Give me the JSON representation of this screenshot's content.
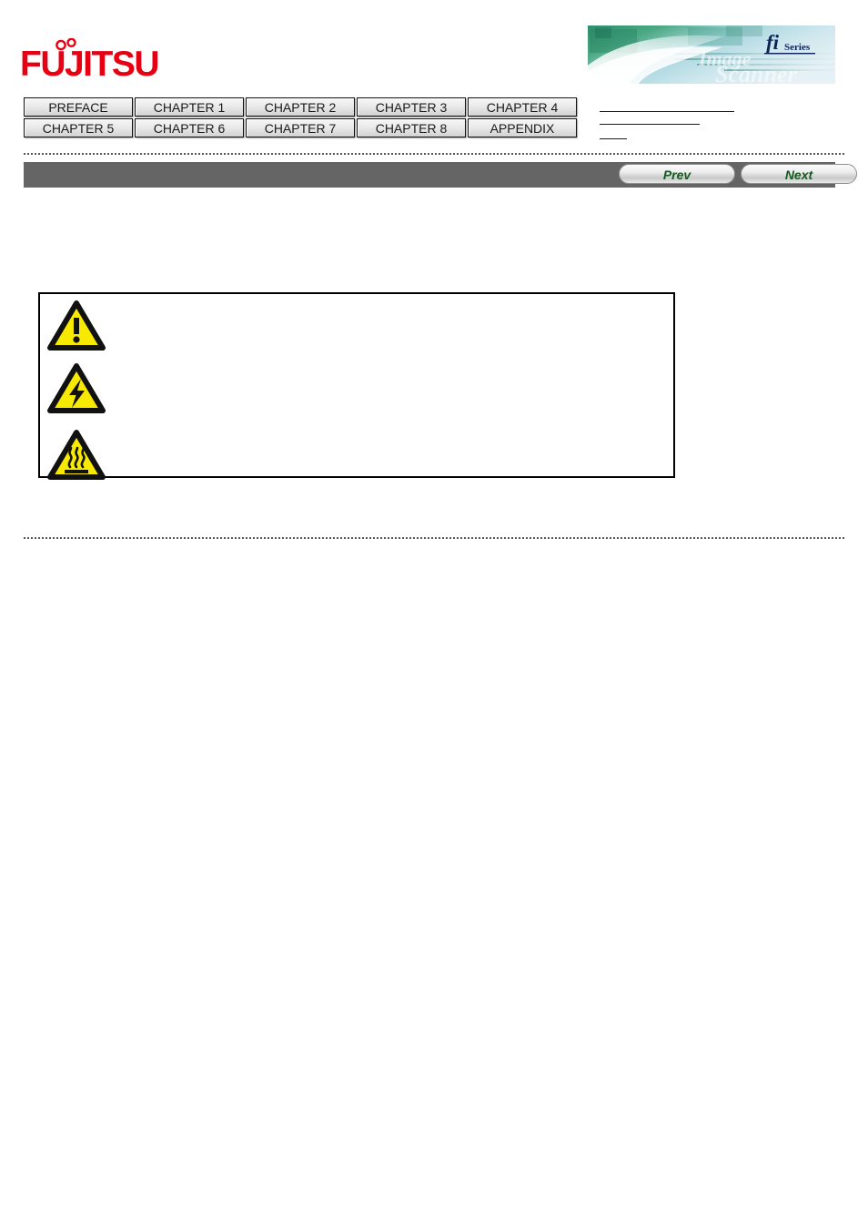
{
  "brand": {
    "logo_text": "FUJITSU",
    "logo_color": "#e60012",
    "banner_title": "fi",
    "banner_subtitle": "Series",
    "banner_watermark_1": "Image",
    "banner_watermark_2": "Scanner"
  },
  "chapter_nav": {
    "rows": [
      [
        {
          "label": "PREFACE"
        },
        {
          "label": "CHAPTER 1"
        },
        {
          "label": "CHAPTER 2"
        },
        {
          "label": "CHAPTER 3"
        },
        {
          "label": "CHAPTER 4"
        }
      ],
      [
        {
          "label": "CHAPTER 5"
        },
        {
          "label": "CHAPTER 6"
        },
        {
          "label": "CHAPTER 7"
        },
        {
          "label": "CHAPTER 8"
        },
        {
          "label": "APPENDIX"
        }
      ]
    ]
  },
  "breadcrumb": {
    "rules": [
      {
        "label": ""
      },
      {
        "label": ""
      },
      {
        "label": ""
      }
    ]
  },
  "toolbar": {
    "background_color": "#656565",
    "prev_label": "Prev",
    "next_label": "Next",
    "label_color": "#13591f"
  },
  "warning_box": {
    "border_color": "#000000",
    "rows": [
      {
        "icon": "warning-triangle-icon",
        "text": ""
      },
      {
        "icon": "electric-shock-icon",
        "text": ""
      },
      {
        "icon": "hot-surface-icon",
        "text": ""
      }
    ]
  },
  "colors": {
    "warning_yellow": "#f7ea00",
    "warning_outline": "#111111",
    "page_background": "#ffffff"
  }
}
